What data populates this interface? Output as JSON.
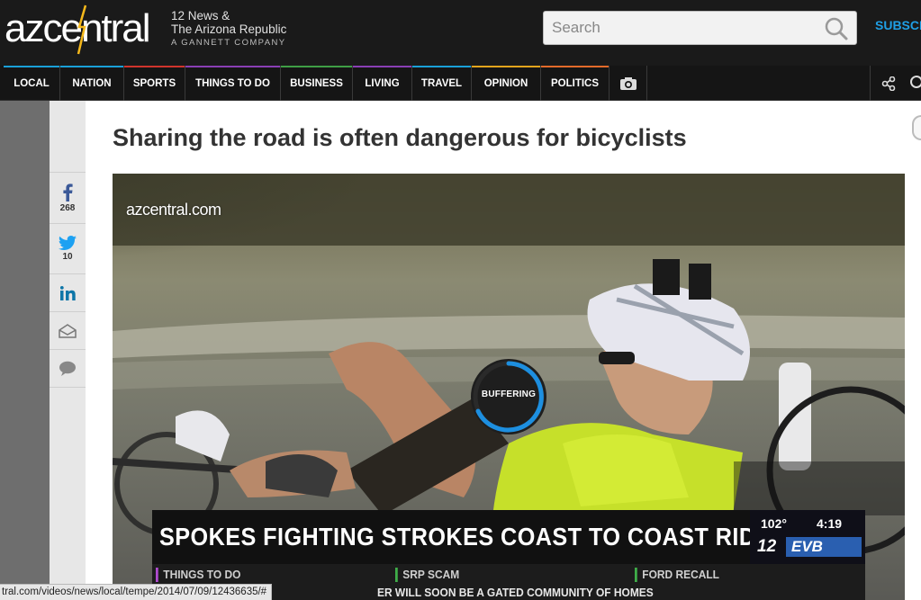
{
  "header": {
    "logo_text": "azcentral",
    "publisher_line1": "12 News &",
    "publisher_line2": "The Arizona Republic",
    "publisher_line3": "A GANNETT COMPANY",
    "search_placeholder": "Search",
    "subscribe_label": "SUBSCR"
  },
  "nav": {
    "items": [
      {
        "label": "LOCAL",
        "color": "#1aa0d8"
      },
      {
        "label": "NATION",
        "color": "#1aa0d8"
      },
      {
        "label": "SPORTS",
        "color": "#d0342c"
      },
      {
        "label": "THINGS TO DO",
        "color": "#8a3fb5"
      },
      {
        "label": "BUSINESS",
        "color": "#3f9f45"
      },
      {
        "label": "LIVING",
        "color": "#8a3fb5"
      },
      {
        "label": "TRAVEL",
        "color": "#1aa0d8"
      },
      {
        "label": "OPINION",
        "color": "#e3a51c"
      },
      {
        "label": "POLITICS",
        "color": "#e36a2a"
      }
    ]
  },
  "share": {
    "facebook_count": "268",
    "twitter_count": "10"
  },
  "article": {
    "headline": "Sharing the road is often dangerous for bicyclists"
  },
  "video": {
    "watermark": "azcentral.com",
    "buffering_label": "BUFFERING",
    "lower_third_title": "SPOKES FIGHTING STROKES COAST TO COAST RIDE",
    "temperature": "102°",
    "time": "4:19",
    "channel": "12",
    "station_tag": "EVB",
    "ticker_items": [
      {
        "label": "THINGS TO DO",
        "color": "#b04bd0"
      },
      {
        "label": "SRP SCAM",
        "color": "#3fae49"
      },
      {
        "label": "FORD RECALL",
        "color": "#3fae49"
      }
    ],
    "ticker_line": "ER WILL SOON BE A GATED COMMUNITY OF HOMES"
  },
  "status_bar": {
    "url": "tral.com/videos/news/local/tempe/2014/07/09/12436635/#"
  },
  "colors": {
    "accent_blue": "#1f9fe5",
    "header_bg": "#1a1a1a"
  }
}
